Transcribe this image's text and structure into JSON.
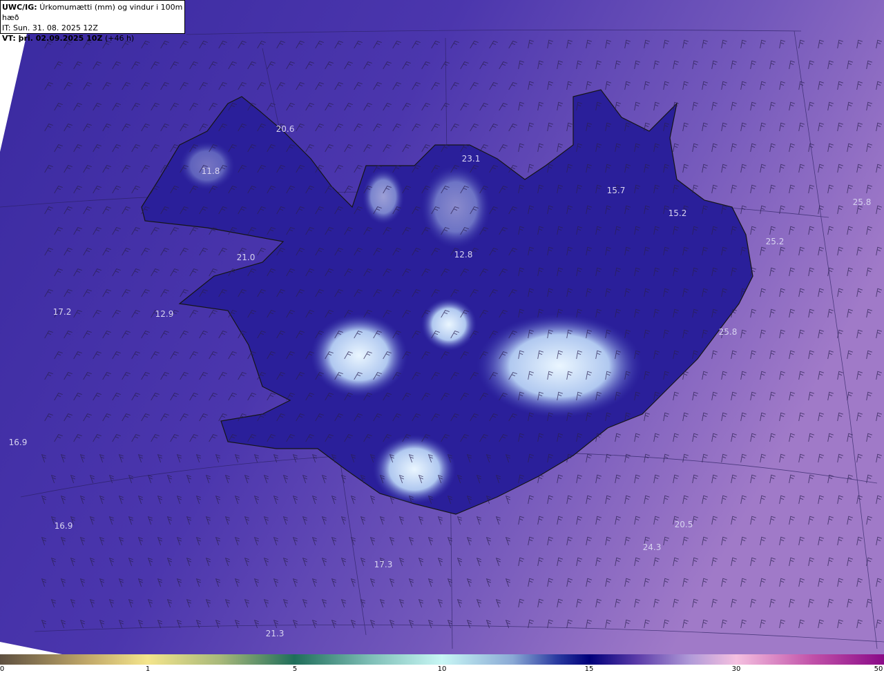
{
  "header": {
    "model": "UWC/IG:",
    "field": "Úrkomumætti (mm) og vindur i 100m hæð",
    "init_time": "IT: Sun. 31. 08. 2025 12Z",
    "valid_label": "VT: þri. 02.09.2025 10Z",
    "lead": "(+46 h)"
  },
  "colorbar": {
    "ticks": [
      "0",
      "1",
      "5",
      "10",
      "15",
      "30",
      "50"
    ],
    "colors": {
      "0": "#5e5040",
      "1": "#f4e58c",
      "5": "#1f6e5a",
      "10": "#c8f7f5",
      "15": "#00007a",
      "30": "#f5c0e0",
      "50": "#8a0a88"
    }
  },
  "map_labels": [
    "20.6",
    "11.8",
    "23.1",
    "15.7",
    "15.2",
    "25.8",
    "25.2",
    "21.0",
    "12.8",
    "17.2",
    "12.9",
    "25.8",
    "16.9",
    "16.9",
    "20.5",
    "24.3",
    "17.3",
    "21.3"
  ],
  "colors": {
    "background": "#4a34a8",
    "land_edge": "#1a1a1a",
    "snow": "#dfeeff"
  }
}
